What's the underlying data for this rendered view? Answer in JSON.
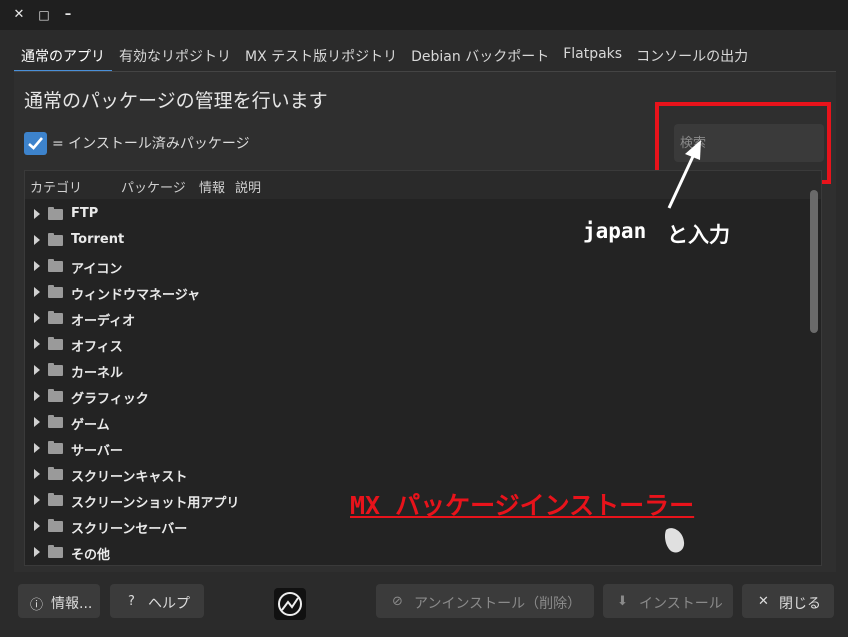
{
  "window": {
    "close_glyph": "✕",
    "maximize_glyph": "□",
    "minimize_glyph": "–"
  },
  "tabs": [
    {
      "label": "通常のアプリ",
      "active": true
    },
    {
      "label": "有効なリポジトリ"
    },
    {
      "label": "MX テスト版リポジトリ"
    },
    {
      "label": "Debian バックポート"
    },
    {
      "label": "Flatpaks"
    },
    {
      "label": "コンソールの出力"
    }
  ],
  "page_title": "通常のパッケージの管理を行います",
  "legend": "= インストール済みパッケージ",
  "search": {
    "placeholder": "検索"
  },
  "tree": {
    "headers": {
      "category": "カテゴリ",
      "package": "パッケージ",
      "info": "情報",
      "description": "説明"
    },
    "items": [
      "FTP",
      "Torrent",
      "アイコン",
      "ウィンドウマネージャ",
      "オーディオ",
      "オフィス",
      "カーネル",
      "グラフィック",
      "ゲーム",
      "サーバー",
      "スクリーンキャスト",
      "スクリーンショット用アプリ",
      "スクリーンセーバー",
      "その他"
    ]
  },
  "annotations": {
    "japan": "japan",
    "input": "と入力",
    "title": "MX パッケージインストーラー"
  },
  "colors": {
    "accent": "#3d83cc",
    "annotation_red": "#e8131b"
  },
  "buttons": {
    "info": "情報...",
    "help": "ヘルプ",
    "uninstall": "アンインストール（削除）",
    "install": "インストール",
    "close": "閉じる"
  }
}
